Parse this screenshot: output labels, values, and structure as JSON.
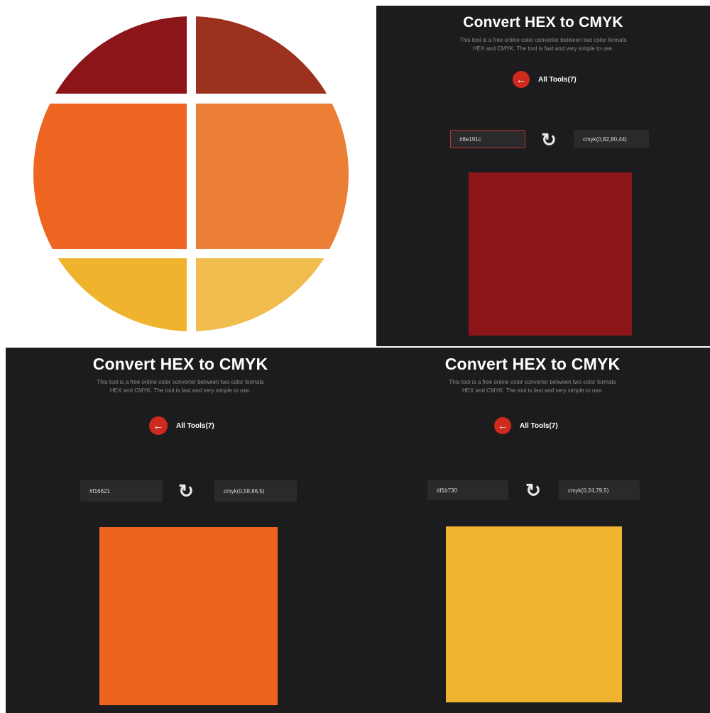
{
  "title": "Convert HEX to CMYK",
  "description": "This tool is a free online color converter between two color formats HEX and CMYK. The tool is fast and very simple to use.",
  "all_tools_label": "All Tools(7)",
  "back_icon": "arrow-left-icon",
  "swap_icon": "swap-arrows-icon",
  "palette": {
    "top_left": "#8b1519",
    "top_right": "#9c321e",
    "mid_left": "#ed6520",
    "mid_right": "#ea7f35",
    "bottom_left": "#f0b32e",
    "bottom_right": "#f0bc4d"
  },
  "panels": [
    {
      "hex_value": "#8e191c",
      "cmyk_value": "cmyk(0,82,80,44)",
      "swatch_color": "#8b1519"
    },
    {
      "hex_value": "#f16621",
      "cmyk_value": "cmyk(0,58,86,5)",
      "swatch_color": "#ee641f"
    },
    {
      "hex_value": "#f1b730",
      "cmyk_value": "cmyk(0,24,79,5)",
      "swatch_color": "#f0b431"
    }
  ]
}
